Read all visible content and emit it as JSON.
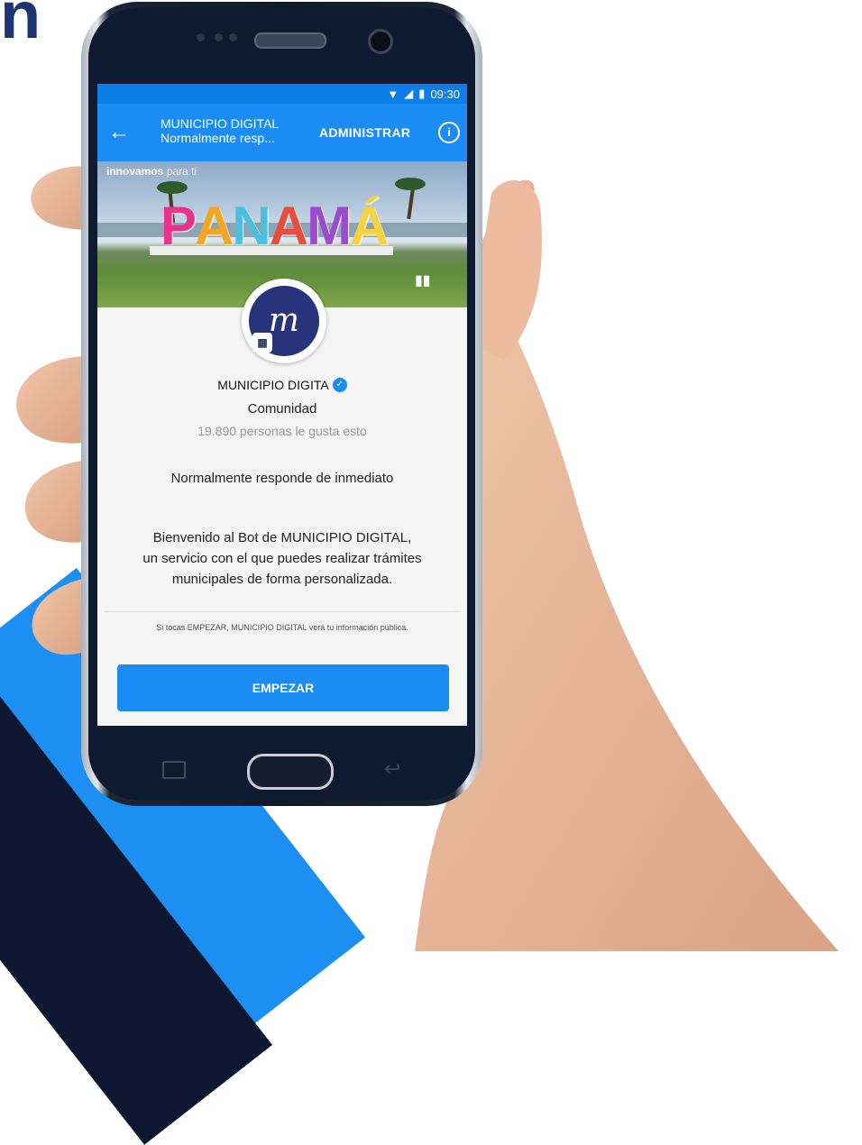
{
  "status_bar": {
    "time": "09:30"
  },
  "app_bar": {
    "title": "MUNICIPIO DIGITAL",
    "subtitle": "Normalmente resp...",
    "admin_label": "ADMINISTRAR",
    "info_label": "i"
  },
  "banner": {
    "tag_bold": "innovamos",
    "tag_light": "para ti",
    "sign_letters": [
      "P",
      "A",
      "N",
      "A",
      "M",
      "Á"
    ],
    "sign_colors": [
      "#e8338b",
      "#f5a623",
      "#4cbfe0",
      "#e94b3c",
      "#9c4bd0",
      "#f7d23e"
    ]
  },
  "profile": {
    "logo_letter": "m",
    "name": "MUNICIPIO DIGITA",
    "category": "Comunidad",
    "likes": "19.890 personas le gusta esto",
    "responds": "Normalmente responde de inmediato",
    "welcome_lines": [
      "Bienvenido al Bot de MUNICIPIO DIGITAL,",
      "un servicio con el que puedes realizar trámites",
      "municipales de forma personalizada."
    ],
    "legal": "Si tocas EMPEZAR, MUNICIPIO DIGITAL verá tu información pública.",
    "start_label": "EMPEZAR"
  },
  "colors": {
    "accent": "#1a8cf3",
    "status": "#0d7ee8"
  }
}
